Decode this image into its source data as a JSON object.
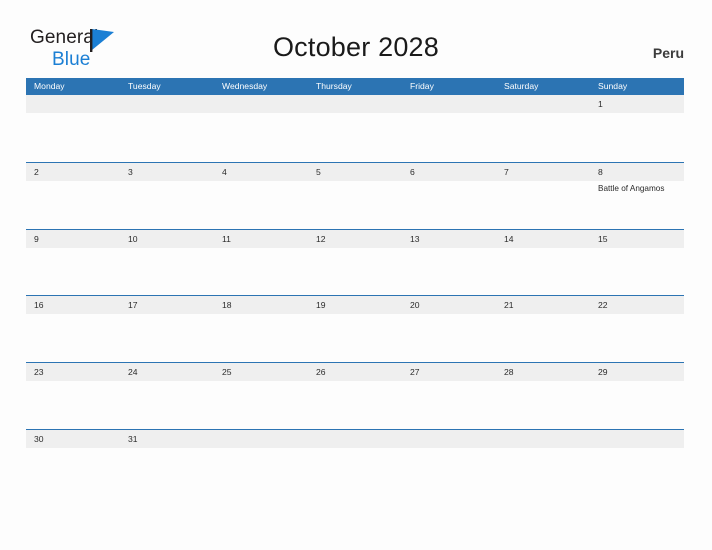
{
  "logo": {
    "word1": "General",
    "word2": "Blue",
    "flag_icon": "blue-triangle-flag-icon",
    "word1_color": "#231f20",
    "word2_color": "#1b7fd4",
    "flag_color": "#1b7fd4"
  },
  "header": {
    "title": "October 2028",
    "country": "Peru"
  },
  "theme": {
    "accent": "#2c74b3",
    "band": "#efefef",
    "page_bg": "#fdfdfd",
    "text": "#2b2b2b"
  },
  "calendar": {
    "weekdays": [
      "Monday",
      "Tuesday",
      "Wednesday",
      "Thursday",
      "Friday",
      "Saturday",
      "Sunday"
    ],
    "weeks": [
      {
        "days": [
          {
            "num": "",
            "events": []
          },
          {
            "num": "",
            "events": []
          },
          {
            "num": "",
            "events": []
          },
          {
            "num": "",
            "events": []
          },
          {
            "num": "",
            "events": []
          },
          {
            "num": "",
            "events": []
          },
          {
            "num": "1",
            "events": []
          }
        ]
      },
      {
        "days": [
          {
            "num": "2",
            "events": []
          },
          {
            "num": "3",
            "events": []
          },
          {
            "num": "4",
            "events": []
          },
          {
            "num": "5",
            "events": []
          },
          {
            "num": "6",
            "events": []
          },
          {
            "num": "7",
            "events": []
          },
          {
            "num": "8",
            "events": [
              "Battle of Angamos"
            ]
          }
        ]
      },
      {
        "days": [
          {
            "num": "9",
            "events": []
          },
          {
            "num": "10",
            "events": []
          },
          {
            "num": "11",
            "events": []
          },
          {
            "num": "12",
            "events": []
          },
          {
            "num": "13",
            "events": []
          },
          {
            "num": "14",
            "events": []
          },
          {
            "num": "15",
            "events": []
          }
        ]
      },
      {
        "days": [
          {
            "num": "16",
            "events": []
          },
          {
            "num": "17",
            "events": []
          },
          {
            "num": "18",
            "events": []
          },
          {
            "num": "19",
            "events": []
          },
          {
            "num": "20",
            "events": []
          },
          {
            "num": "21",
            "events": []
          },
          {
            "num": "22",
            "events": []
          }
        ]
      },
      {
        "days": [
          {
            "num": "23",
            "events": []
          },
          {
            "num": "24",
            "events": []
          },
          {
            "num": "25",
            "events": []
          },
          {
            "num": "26",
            "events": []
          },
          {
            "num": "27",
            "events": []
          },
          {
            "num": "28",
            "events": []
          },
          {
            "num": "29",
            "events": []
          }
        ]
      },
      {
        "days": [
          {
            "num": "30",
            "events": []
          },
          {
            "num": "31",
            "events": []
          },
          {
            "num": "",
            "events": []
          },
          {
            "num": "",
            "events": []
          },
          {
            "num": "",
            "events": []
          },
          {
            "num": "",
            "events": []
          },
          {
            "num": "",
            "events": []
          }
        ]
      }
    ]
  }
}
